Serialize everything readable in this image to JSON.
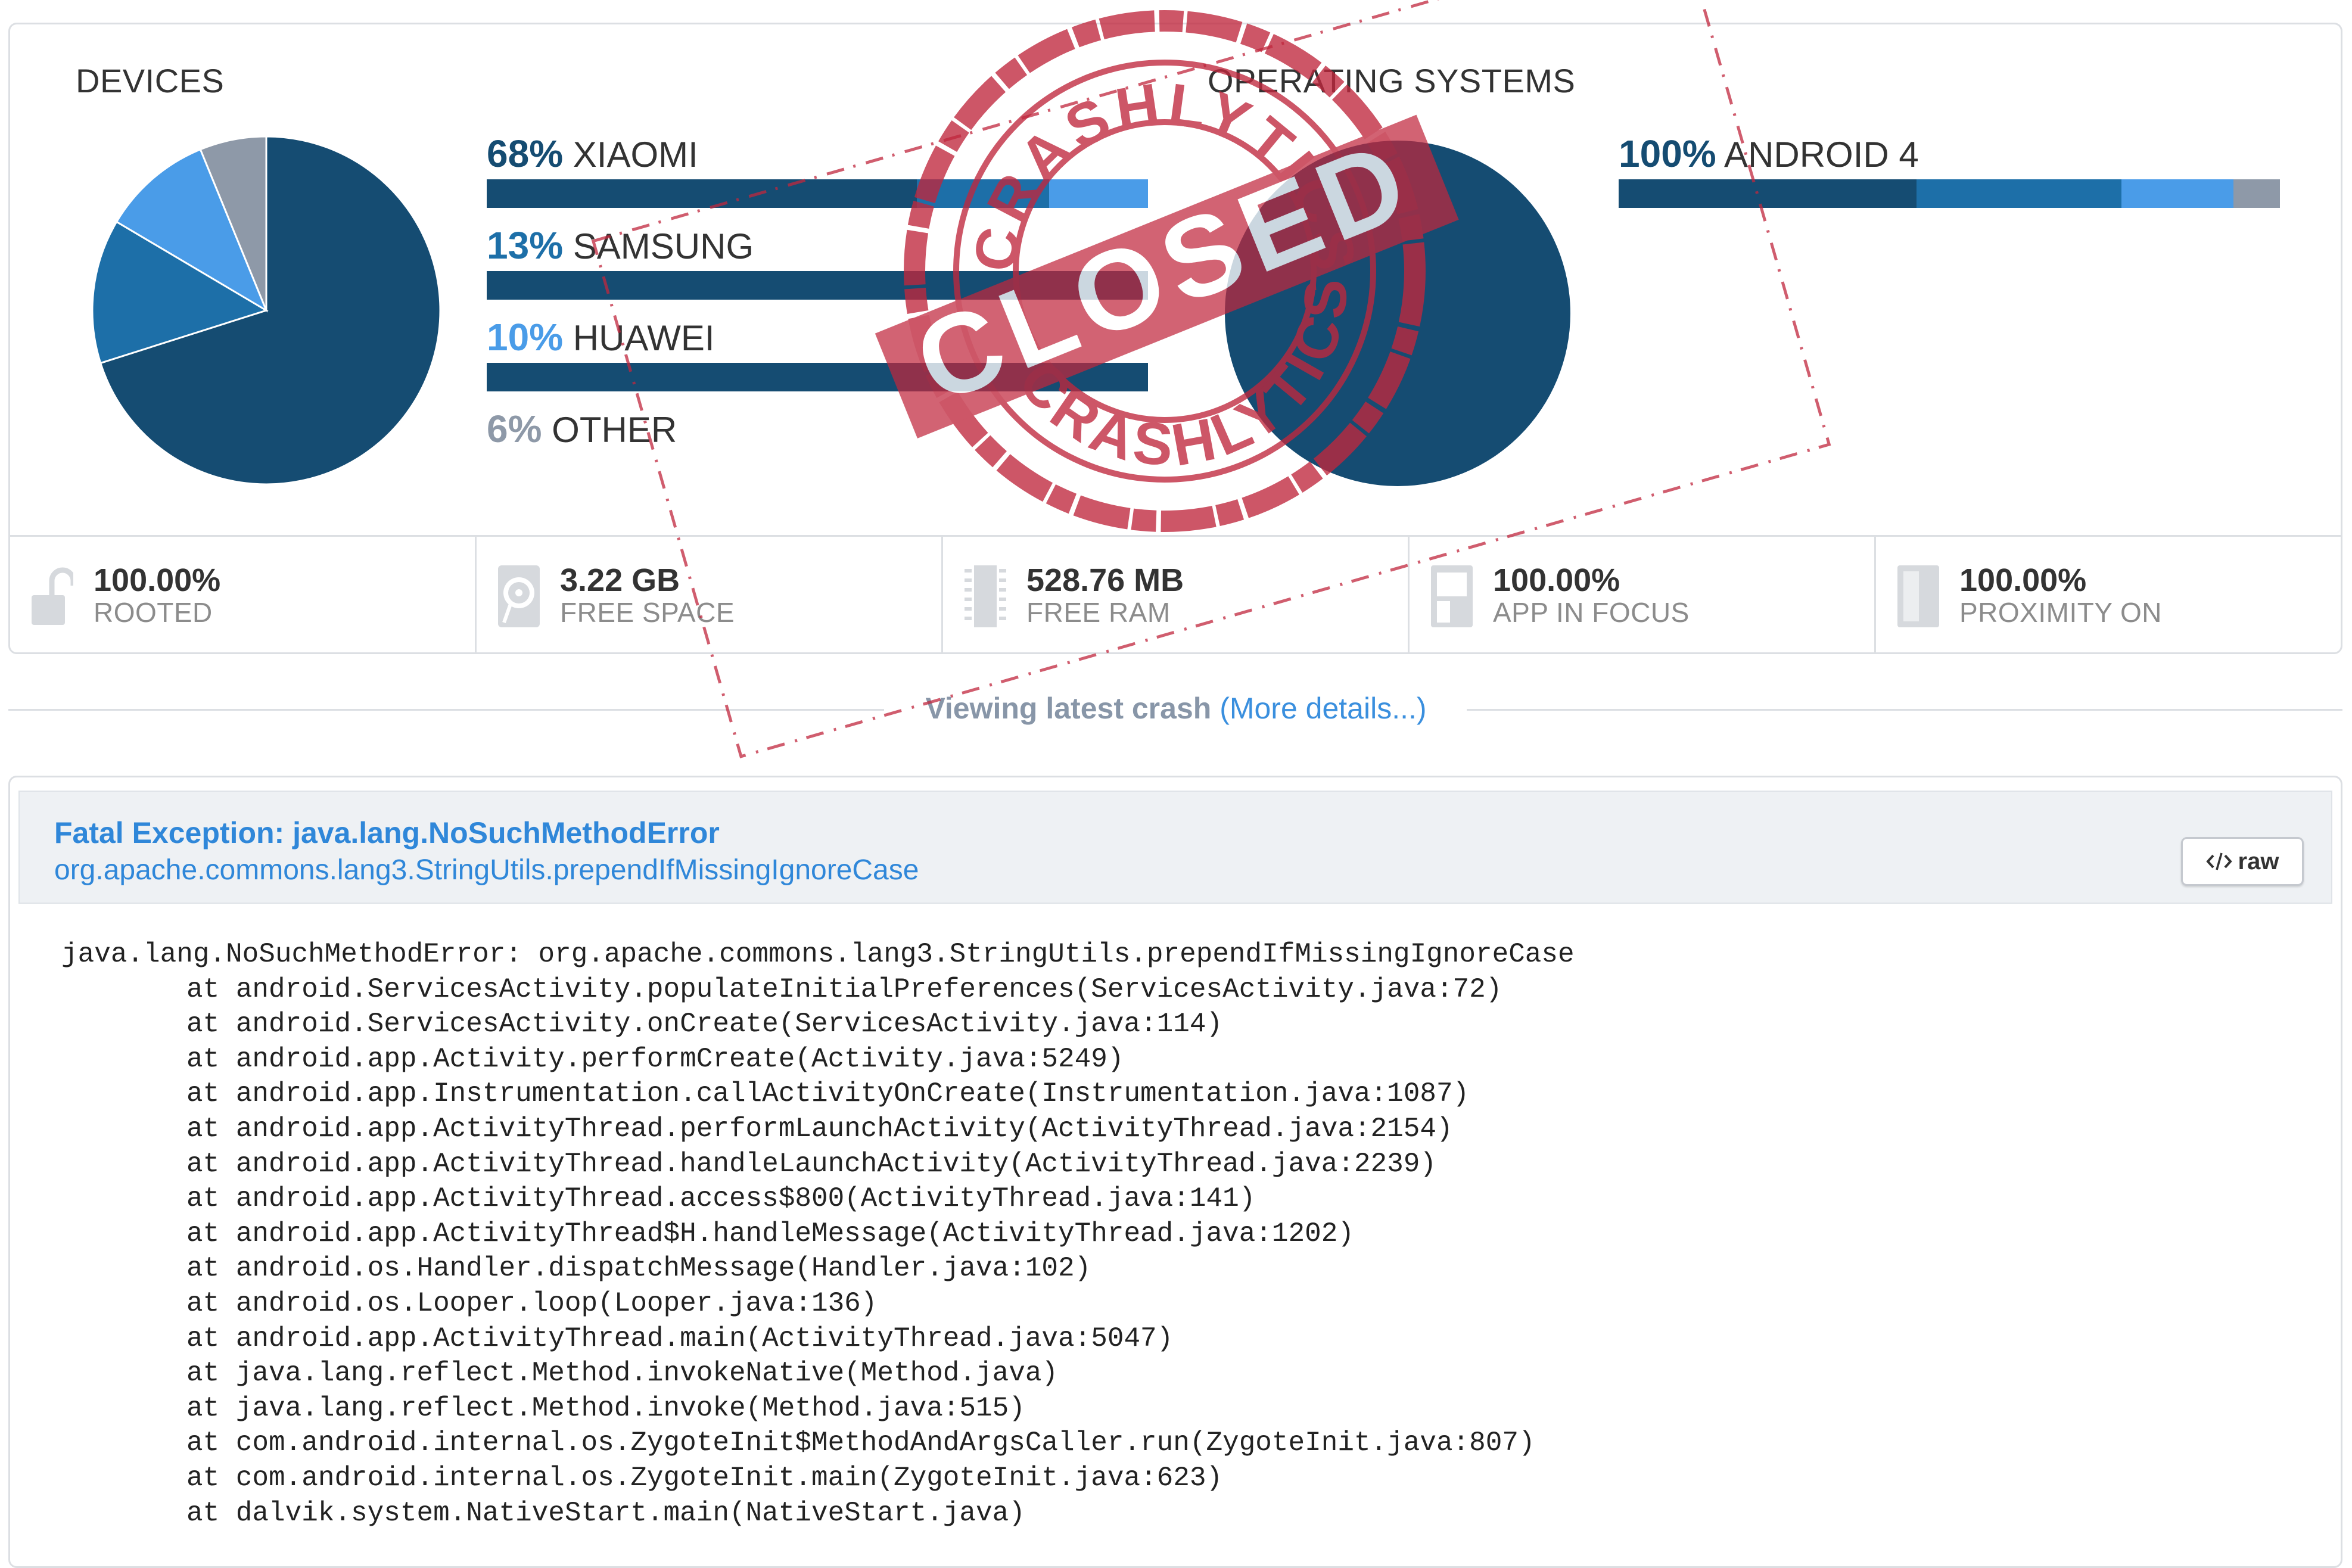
{
  "devices": {
    "title": "DEVICES",
    "pie": [
      {
        "name": "XIAOMI",
        "value": 68,
        "color": "#154c72"
      },
      {
        "name": "SAMSUNG",
        "value": 13,
        "color": "#1d6fa8"
      },
      {
        "name": "HUAWEI",
        "value": 10,
        "color": "#4a9ce8"
      },
      {
        "name": "OTHER",
        "value": 6,
        "color": "#8e99a8"
      }
    ],
    "legend": [
      {
        "pct": "68%",
        "name": "XIAOMI",
        "pct_color": "#154c72",
        "bar": [
          {
            "v": 65,
            "c": "#154c72"
          },
          {
            "v": 20,
            "c": "#1d6fa8"
          },
          {
            "v": 15,
            "c": "#4a9ce8"
          }
        ]
      },
      {
        "pct": "13%",
        "name": "SAMSUNG",
        "pct_color": "#1d6fa8",
        "bar": [
          {
            "v": 100,
            "c": "#154c72"
          }
        ]
      },
      {
        "pct": "10%",
        "name": "HUAWEI",
        "pct_color": "#4a9ce8",
        "bar": [
          {
            "v": 100,
            "c": "#154c72"
          }
        ]
      },
      {
        "pct": "6%",
        "name": "OTHER",
        "pct_color": "#8e99a8",
        "bar": []
      }
    ]
  },
  "os": {
    "title": "OPERATING SYSTEMS",
    "pie": [
      {
        "name": "ANDROID 4",
        "value": 100,
        "color": "#154c72"
      }
    ],
    "legend": [
      {
        "pct": "100%",
        "name": "ANDROID 4",
        "pct_color": "#154c72",
        "bar": [
          {
            "v": 45,
            "c": "#154c72"
          },
          {
            "v": 31,
            "c": "#1d6fa8"
          },
          {
            "v": 17,
            "c": "#4a9ce8"
          },
          {
            "v": 7,
            "c": "#8e99a8"
          }
        ]
      }
    ]
  },
  "stats": [
    {
      "value": "100.00%",
      "label": "ROOTED",
      "icon": "unlock-icon"
    },
    {
      "value": "3.22 GB",
      "label": "FREE SPACE",
      "icon": "disk-icon"
    },
    {
      "value": "528.76 MB",
      "label": "FREE RAM",
      "icon": "ram-icon"
    },
    {
      "value": "100.00%",
      "label": "APP IN FOCUS",
      "icon": "app-focus-icon"
    },
    {
      "value": "100.00%",
      "label": "PROXIMITY ON",
      "icon": "proximity-icon"
    }
  ],
  "viewing": {
    "text": "Viewing latest crash",
    "link": "(More details...)"
  },
  "crash": {
    "title": "Fatal Exception: java.lang.NoSuchMethodError",
    "subtitle": "org.apache.commons.lang3.StringUtils.prependIfMissingIgnoreCase",
    "raw_label": "raw",
    "raw_icon": "code-icon",
    "trace_head": "java.lang.NoSuchMethodError: org.apache.commons.lang3.StringUtils.prependIfMissingIgnoreCase",
    "trace": [
      "at android.ServicesActivity.populateInitialPreferences(ServicesActivity.java:72)",
      "at android.ServicesActivity.onCreate(ServicesActivity.java:114)",
      "at android.app.Activity.performCreate(Activity.java:5249)",
      "at android.app.Instrumentation.callActivityOnCreate(Instrumentation.java:1087)",
      "at android.app.ActivityThread.performLaunchActivity(ActivityThread.java:2154)",
      "at android.app.ActivityThread.handleLaunchActivity(ActivityThread.java:2239)",
      "at android.app.ActivityThread.access$800(ActivityThread.java:141)",
      "at android.app.ActivityThread$H.handleMessage(ActivityThread.java:1202)",
      "at android.os.Handler.dispatchMessage(Handler.java:102)",
      "at android.os.Looper.loop(Looper.java:136)",
      "at android.app.ActivityThread.main(ActivityThread.java:5047)",
      "at java.lang.reflect.Method.invokeNative(Method.java)",
      "at java.lang.reflect.Method.invoke(Method.java:515)",
      "at com.android.internal.os.ZygoteInit$MethodAndArgsCaller.run(ZygoteInit.java:807)",
      "at com.android.internal.os.ZygoteInit.main(ZygoteInit.java:623)",
      "at dalvik.system.NativeStart.main(NativeStart.java)"
    ]
  },
  "stamp": {
    "word": "CLOSED",
    "ring_text": "CRASHLYTICS",
    "color": "#c0273d"
  }
}
